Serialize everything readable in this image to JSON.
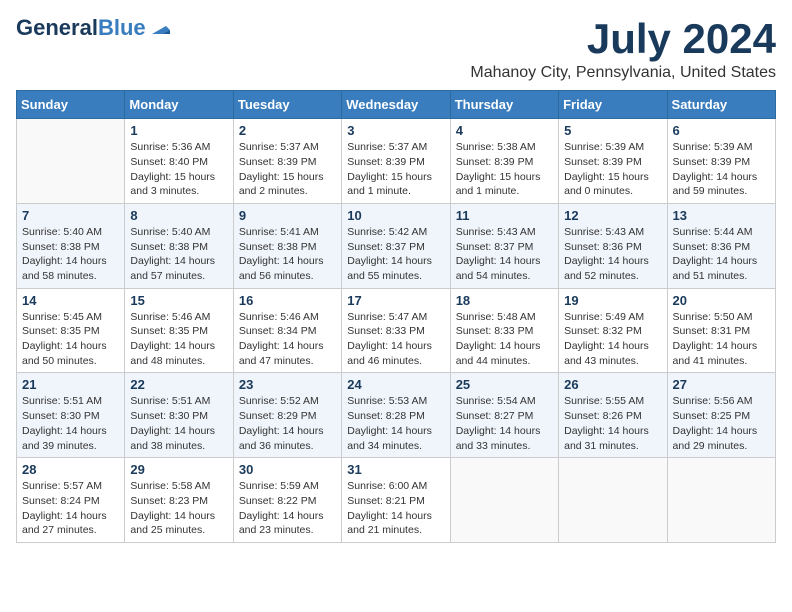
{
  "header": {
    "logo_general": "General",
    "logo_blue": "Blue",
    "month_title": "July 2024",
    "location": "Mahanoy City, Pennsylvania, United States"
  },
  "days_of_week": [
    "Sunday",
    "Monday",
    "Tuesday",
    "Wednesday",
    "Thursday",
    "Friday",
    "Saturday"
  ],
  "weeks": [
    [
      {
        "day": "",
        "info": ""
      },
      {
        "day": "1",
        "info": "Sunrise: 5:36 AM\nSunset: 8:40 PM\nDaylight: 15 hours\nand 3 minutes."
      },
      {
        "day": "2",
        "info": "Sunrise: 5:37 AM\nSunset: 8:39 PM\nDaylight: 15 hours\nand 2 minutes."
      },
      {
        "day": "3",
        "info": "Sunrise: 5:37 AM\nSunset: 8:39 PM\nDaylight: 15 hours\nand 1 minute."
      },
      {
        "day": "4",
        "info": "Sunrise: 5:38 AM\nSunset: 8:39 PM\nDaylight: 15 hours\nand 1 minute."
      },
      {
        "day": "5",
        "info": "Sunrise: 5:39 AM\nSunset: 8:39 PM\nDaylight: 15 hours\nand 0 minutes."
      },
      {
        "day": "6",
        "info": "Sunrise: 5:39 AM\nSunset: 8:39 PM\nDaylight: 14 hours\nand 59 minutes."
      }
    ],
    [
      {
        "day": "7",
        "info": "Sunrise: 5:40 AM\nSunset: 8:38 PM\nDaylight: 14 hours\nand 58 minutes."
      },
      {
        "day": "8",
        "info": "Sunrise: 5:40 AM\nSunset: 8:38 PM\nDaylight: 14 hours\nand 57 minutes."
      },
      {
        "day": "9",
        "info": "Sunrise: 5:41 AM\nSunset: 8:38 PM\nDaylight: 14 hours\nand 56 minutes."
      },
      {
        "day": "10",
        "info": "Sunrise: 5:42 AM\nSunset: 8:37 PM\nDaylight: 14 hours\nand 55 minutes."
      },
      {
        "day": "11",
        "info": "Sunrise: 5:43 AM\nSunset: 8:37 PM\nDaylight: 14 hours\nand 54 minutes."
      },
      {
        "day": "12",
        "info": "Sunrise: 5:43 AM\nSunset: 8:36 PM\nDaylight: 14 hours\nand 52 minutes."
      },
      {
        "day": "13",
        "info": "Sunrise: 5:44 AM\nSunset: 8:36 PM\nDaylight: 14 hours\nand 51 minutes."
      }
    ],
    [
      {
        "day": "14",
        "info": "Sunrise: 5:45 AM\nSunset: 8:35 PM\nDaylight: 14 hours\nand 50 minutes."
      },
      {
        "day": "15",
        "info": "Sunrise: 5:46 AM\nSunset: 8:35 PM\nDaylight: 14 hours\nand 48 minutes."
      },
      {
        "day": "16",
        "info": "Sunrise: 5:46 AM\nSunset: 8:34 PM\nDaylight: 14 hours\nand 47 minutes."
      },
      {
        "day": "17",
        "info": "Sunrise: 5:47 AM\nSunset: 8:33 PM\nDaylight: 14 hours\nand 46 minutes."
      },
      {
        "day": "18",
        "info": "Sunrise: 5:48 AM\nSunset: 8:33 PM\nDaylight: 14 hours\nand 44 minutes."
      },
      {
        "day": "19",
        "info": "Sunrise: 5:49 AM\nSunset: 8:32 PM\nDaylight: 14 hours\nand 43 minutes."
      },
      {
        "day": "20",
        "info": "Sunrise: 5:50 AM\nSunset: 8:31 PM\nDaylight: 14 hours\nand 41 minutes."
      }
    ],
    [
      {
        "day": "21",
        "info": "Sunrise: 5:51 AM\nSunset: 8:30 PM\nDaylight: 14 hours\nand 39 minutes."
      },
      {
        "day": "22",
        "info": "Sunrise: 5:51 AM\nSunset: 8:30 PM\nDaylight: 14 hours\nand 38 minutes."
      },
      {
        "day": "23",
        "info": "Sunrise: 5:52 AM\nSunset: 8:29 PM\nDaylight: 14 hours\nand 36 minutes."
      },
      {
        "day": "24",
        "info": "Sunrise: 5:53 AM\nSunset: 8:28 PM\nDaylight: 14 hours\nand 34 minutes."
      },
      {
        "day": "25",
        "info": "Sunrise: 5:54 AM\nSunset: 8:27 PM\nDaylight: 14 hours\nand 33 minutes."
      },
      {
        "day": "26",
        "info": "Sunrise: 5:55 AM\nSunset: 8:26 PM\nDaylight: 14 hours\nand 31 minutes."
      },
      {
        "day": "27",
        "info": "Sunrise: 5:56 AM\nSunset: 8:25 PM\nDaylight: 14 hours\nand 29 minutes."
      }
    ],
    [
      {
        "day": "28",
        "info": "Sunrise: 5:57 AM\nSunset: 8:24 PM\nDaylight: 14 hours\nand 27 minutes."
      },
      {
        "day": "29",
        "info": "Sunrise: 5:58 AM\nSunset: 8:23 PM\nDaylight: 14 hours\nand 25 minutes."
      },
      {
        "day": "30",
        "info": "Sunrise: 5:59 AM\nSunset: 8:22 PM\nDaylight: 14 hours\nand 23 minutes."
      },
      {
        "day": "31",
        "info": "Sunrise: 6:00 AM\nSunset: 8:21 PM\nDaylight: 14 hours\nand 21 minutes."
      },
      {
        "day": "",
        "info": ""
      },
      {
        "day": "",
        "info": ""
      },
      {
        "day": "",
        "info": ""
      }
    ]
  ]
}
